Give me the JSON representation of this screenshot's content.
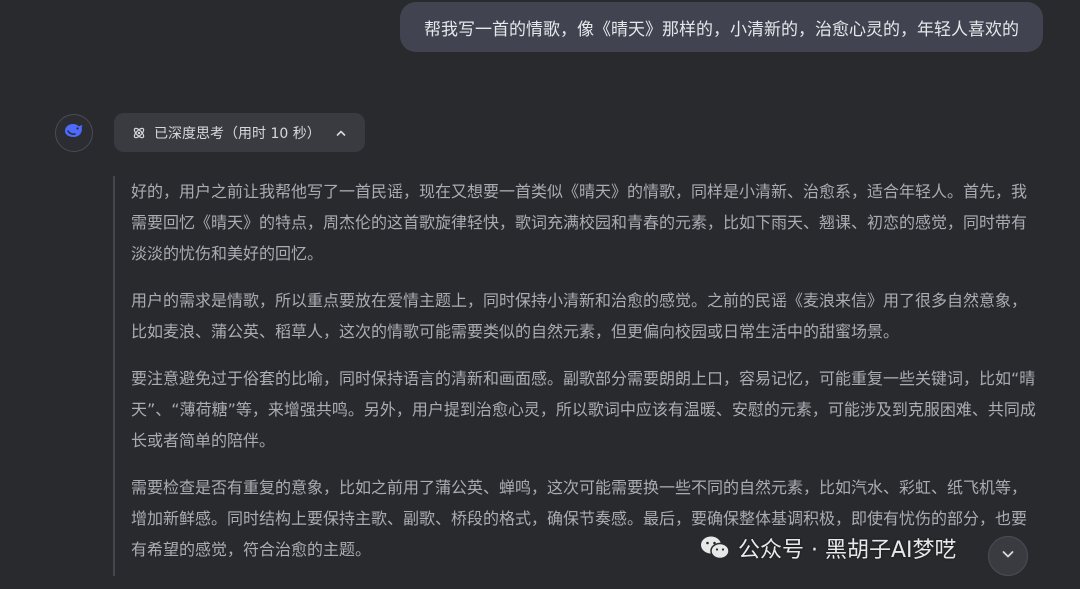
{
  "user_message": {
    "text": "帮我写一首的情歌，像《晴天》那样的，小清新的，治愈心灵的，年轻人喜欢的"
  },
  "assistant": {
    "avatar_icon": "whale-logo-icon",
    "think_toggle": {
      "icon": "atom-icon",
      "label": "已深度思考（用时 10 秒）",
      "chevron_icon": "chevron-up-icon"
    },
    "thinking_paragraphs": [
      "好的，用户之前让我帮他写了一首民谣，现在又想要一首类似《晴天》的情歌，同样是小清新、治愈系，适合年轻人。首先，我需要回忆《晴天》的特点，周杰伦的这首歌旋律轻快，歌词充满校园和青春的元素，比如下雨天、翘课、初恋的感觉，同时带有淡淡的忧伤和美好的回忆。",
      "用户的需求是情歌，所以重点要放在爱情主题上，同时保持小清新和治愈的感觉。之前的民谣《麦浪来信》用了很多自然意象，比如麦浪、蒲公英、稻草人，这次的情歌可能需要类似的自然元素，但更偏向校园或日常生活中的甜蜜场景。",
      "要注意避免过于俗套的比喻，同时保持语言的清新和画面感。副歌部分需要朗朗上口，容易记忆，可能重复一些关键词，比如“晴天”、“薄荷糖”等，来增强共鸣。另外，用户提到治愈心灵，所以歌词中应该有温暖、安慰的元素，可能涉及到克服困难、共同成长或者简单的陪伴。",
      "需要检查是否有重复的意象，比如之前用了蒲公英、蝉鸣，这次可能需要换一些不同的自然元素，比如汽水、彩虹、纸飞机等，增加新鲜感。同时结构上要保持主歌、副歌、桥段的格式，确保节奏感。最后，要确保整体基调积极，即使有忧伤的部分，也要有希望的感觉，符合治愈的主题。"
    ]
  },
  "watermark": {
    "icon": "wechat-icon",
    "text": "公众号 · 黑胡子AI梦呓"
  },
  "scroll_button": {
    "icon": "chevron-down-icon"
  },
  "colors": {
    "background": "#292a2e",
    "user_bubble": "#414350",
    "think_toggle_bg": "#3a3b41",
    "accent_blue": "#4d6bfe",
    "thinking_text": "#a9acb3"
  }
}
